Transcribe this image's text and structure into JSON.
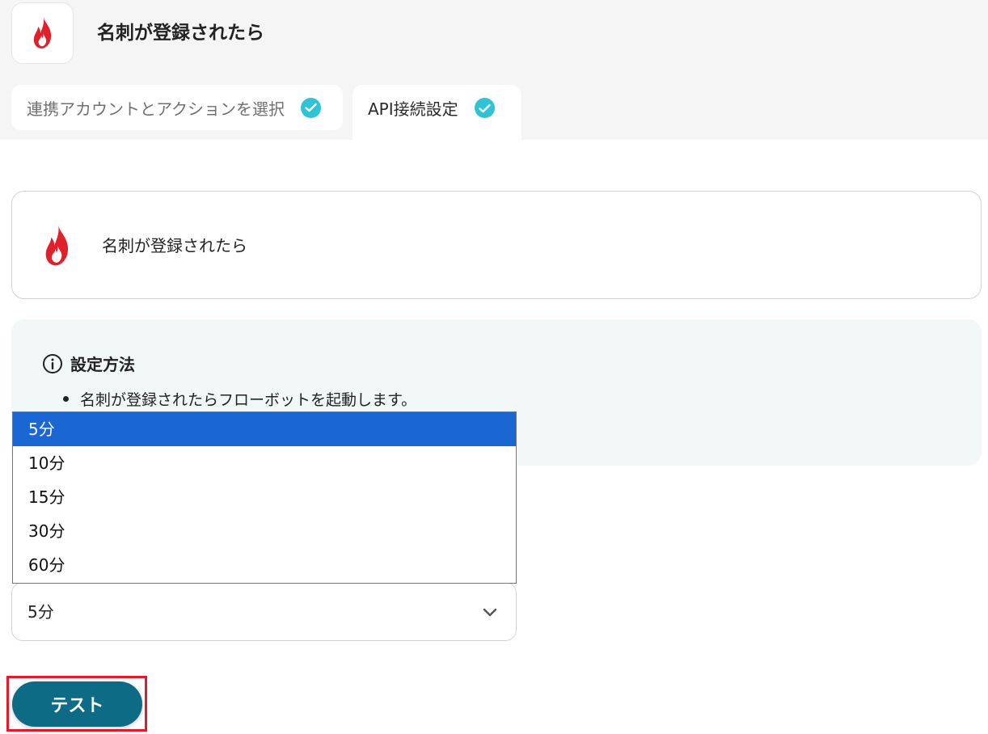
{
  "header": {
    "title": "名刺が登録されたら",
    "app_icon": "flame-icon"
  },
  "tabs": [
    {
      "label": "連携アカウントとアクションを選択",
      "status_icon": "check-circle-icon",
      "active": false
    },
    {
      "label": "API接続設定",
      "status_icon": "check-circle-icon",
      "active": true
    }
  ],
  "trigger_card": {
    "title": "名刺が登録されたら",
    "icon": "flame-icon"
  },
  "info": {
    "heading": "設定方法",
    "icon": "info-circle-icon",
    "bullets": [
      "名刺が登録されたらフローボットを起動します。"
    ]
  },
  "interval_select": {
    "value": "5分",
    "options": [
      "5分",
      "10分",
      "15分",
      "30分",
      "60分"
    ],
    "selected_index": 0
  },
  "test_button": {
    "label": "テスト"
  },
  "colors": {
    "accent_teal": "#0e6b86",
    "check_cyan": "#2ec4d6",
    "highlight_red": "#e11b2c",
    "flame_red": "#e0202a",
    "selected_option": "#1a66d2",
    "info_bg": "#f1f8f7"
  }
}
